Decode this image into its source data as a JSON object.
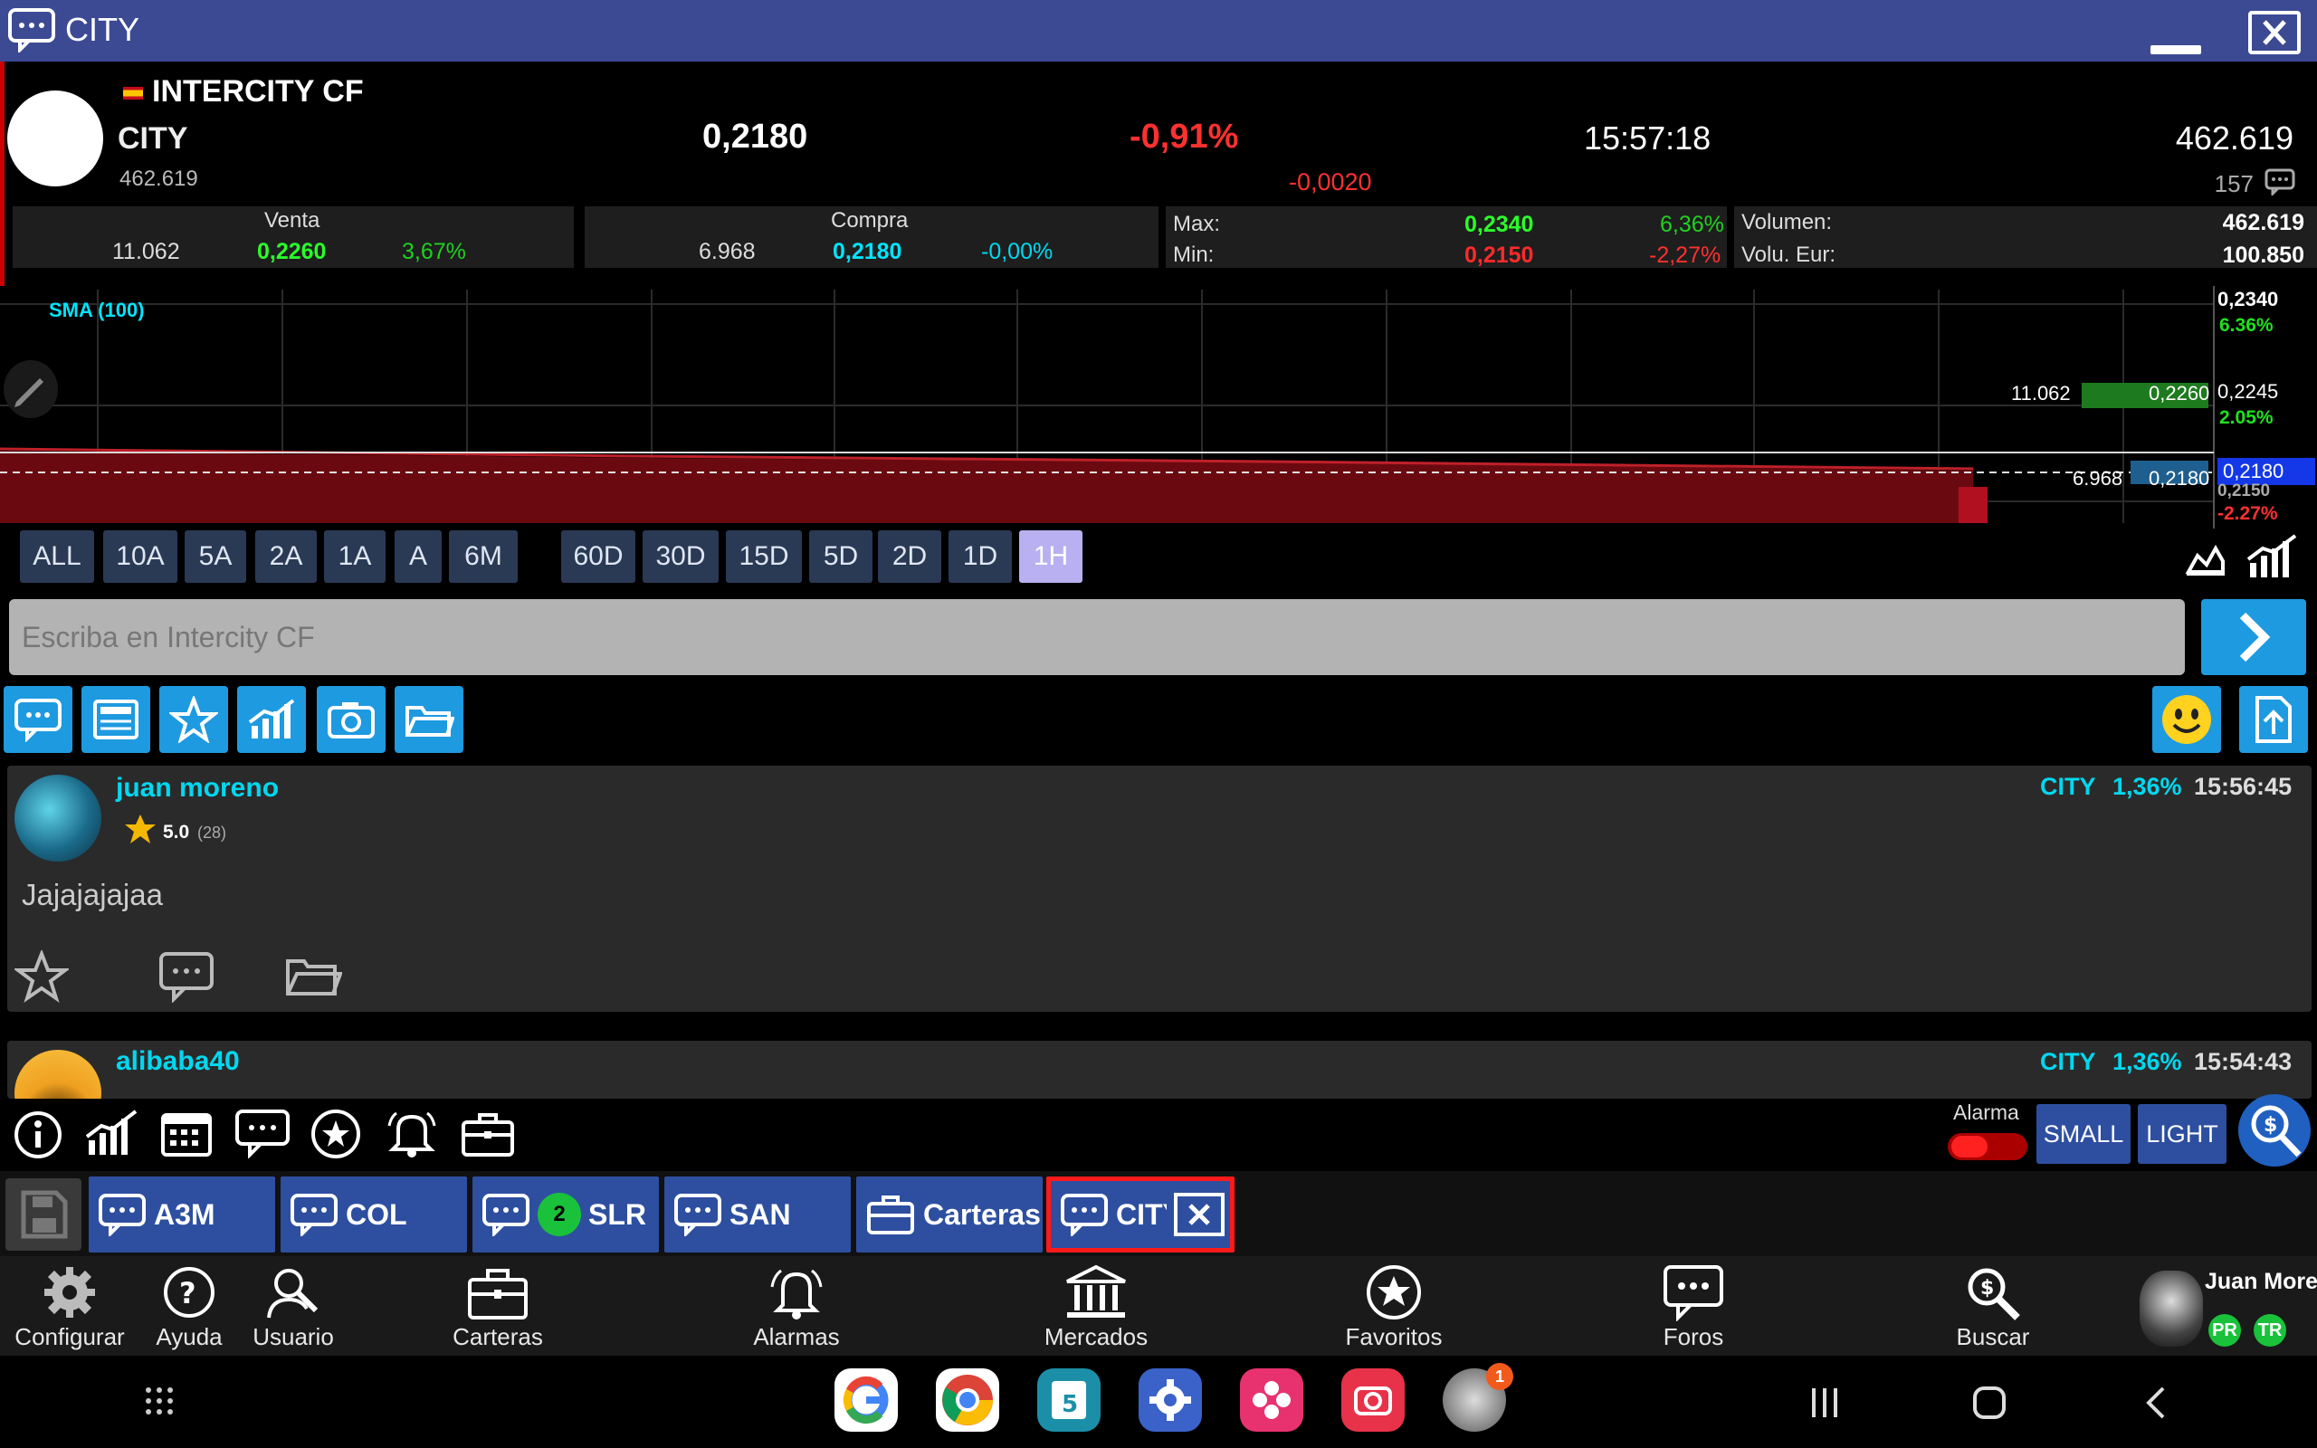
{
  "window": {
    "title": "CITY"
  },
  "header": {
    "company_name": "INTERCITY CF",
    "ticker": "CITY",
    "volume_small": "462.619",
    "price": "0,2180",
    "change_pct": "-0,91%",
    "change_abs": "-0,0020",
    "time": "15:57:18",
    "volume": "462.619",
    "comments_count": "157"
  },
  "venta": {
    "label": "Venta",
    "qty": "11.062",
    "price": "0,2260",
    "pct": "3,67%"
  },
  "compra": {
    "label": "Compra",
    "qty": "6.968",
    "price": "0,2180",
    "pct": "-0,00%"
  },
  "maxmin": {
    "max_label": "Max:",
    "max_price": "0,2340",
    "max_pct": "6,36%",
    "min_label": "Min:",
    "min_price": "0,2150",
    "min_pct": "-2,27%"
  },
  "volbox": {
    "vol_label": "Volumen:",
    "vol_value": "462.619",
    "eur_label": "Volu. Eur:",
    "eur_value": "100.850"
  },
  "chart": {
    "indicator": "SMA (100)",
    "axis": {
      "top_price": "0,2340",
      "top_pct": "6.36%",
      "mid_price": "0,2245",
      "mid_pct": "2.05%",
      "cur_price": "0,2180",
      "bottom_price": "0,2150",
      "bottom_pct": "-2.27%"
    },
    "venta_qty": "11.062",
    "venta_price": "0,2260",
    "compra_qty": "6.968",
    "compra_price": "0,2180"
  },
  "ranges": [
    "ALL",
    "10A",
    "5A",
    "2A",
    "1A",
    "A",
    "6M",
    "60D",
    "30D",
    "15D",
    "5D",
    "2D",
    "1D",
    "1H"
  ],
  "active_range": "1H",
  "composer": {
    "placeholder": "Escriba en Intercity CF"
  },
  "posts": [
    {
      "user": "juan moreno",
      "rating": "5.0",
      "votes": "(28)",
      "ticker": "CITY",
      "pct": "1,36%",
      "time": "15:56:45",
      "body": "Jajajajajaa"
    },
    {
      "user": "alibaba40",
      "ticker": "CITY",
      "pct": "1,36%",
      "time": "15:54:43"
    }
  ],
  "toolrow": {
    "alarma_label": "Alarma",
    "small_label": "SMALL",
    "light_label": "LIGHT"
  },
  "tabs": [
    {
      "label": "A3M"
    },
    {
      "label": "COL"
    },
    {
      "label": "SLR",
      "badge": "2"
    },
    {
      "label": "SAN"
    },
    {
      "label": "Carteras"
    },
    {
      "label": "CITY"
    }
  ],
  "bottom_nav": {
    "configurar": "Configurar",
    "ayuda": "Ayuda",
    "usuario": "Usuario",
    "carteras": "Carteras",
    "alarmas": "Alarmas",
    "mercados": "Mercados",
    "favoritos": "Favoritos",
    "foros": "Foros",
    "buscar": "Buscar"
  },
  "user": {
    "name": "Juan Moreno",
    "badge_pr": "PR",
    "badge_tr": "TR"
  },
  "notification_count": "1",
  "calendar_day": "5",
  "colors": {
    "title_bar": "#3c4a94",
    "accent_blue": "#1e9ae0",
    "tab_blue": "#2e4fa0",
    "up_green": "#20d020",
    "down_red": "#ff3030",
    "cyan": "#00d8f0"
  }
}
